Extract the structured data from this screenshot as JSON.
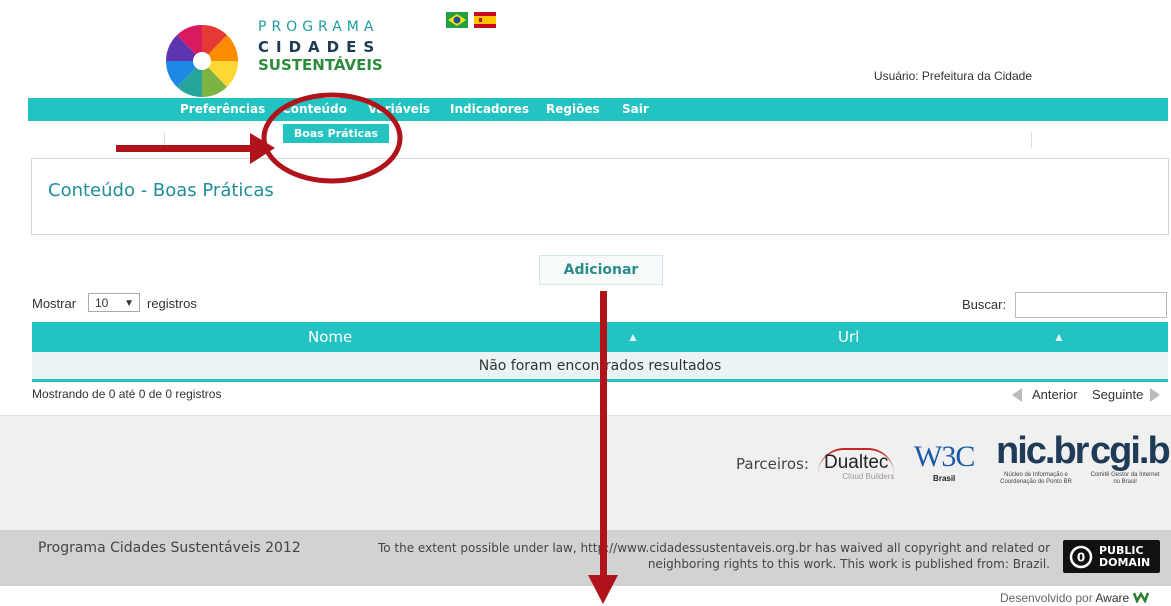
{
  "header": {
    "logo_line1": "PROGRAMA",
    "logo_line2": "CIDADES",
    "logo_line3": "SUSTENTÁVEIS",
    "flags": [
      "brazil-flag-icon",
      "spain-flag-icon"
    ],
    "user_label": "Usuário: Prefeitura da Cidade"
  },
  "nav": {
    "items": [
      {
        "label": "Preferências"
      },
      {
        "label": "Conteúdo"
      },
      {
        "label": "Variáveis"
      },
      {
        "label": "Indicadores"
      },
      {
        "label": "Regiões"
      },
      {
        "label": "Sair"
      }
    ],
    "submenu_item": "Boas Práticas"
  },
  "page": {
    "title": "Conteúdo - Boas Práticas",
    "add_button": "Adicionar"
  },
  "table_controls": {
    "show_prefix": "Mostrar",
    "show_value": "10",
    "show_suffix": "registros",
    "search_label": "Buscar:",
    "search_value": ""
  },
  "table": {
    "columns": [
      "Nome",
      "Url"
    ],
    "empty_message": "Não foram encontrados resultados",
    "info": "Mostrando de 0 até 0 de 0 registros",
    "prev_label": "Anterior",
    "next_label": "Seguinte"
  },
  "footer": {
    "partners_label": "Parceiros:",
    "partners": [
      {
        "name": "Dualtec",
        "sub": "Cloud Builders"
      },
      {
        "name": "W3C",
        "sub": "Brasil"
      },
      {
        "name": "nic.br",
        "sub": "Núcleo de Informação e Coordenação do Ponto BR"
      },
      {
        "name": "cgi.br",
        "sub": "Comitê Gestor da Internet no Brasil"
      }
    ],
    "copyright": "Programa Cidades Sustentáveis 2012",
    "license": "To the extent possible under law, http://www.cidadessustentaveis.org.br has waived all copyright and related or neighboring rights to this work. This work is published from: Brazil.",
    "pd_badge_line1": "PUBLIC",
    "pd_badge_line2": "DOMAIN",
    "developed_by": "Desenvolvido por",
    "developer": "Aware"
  },
  "colors": {
    "accent": "#22c3c1",
    "title": "#1f8e9b",
    "annotation": "#b0141a"
  }
}
